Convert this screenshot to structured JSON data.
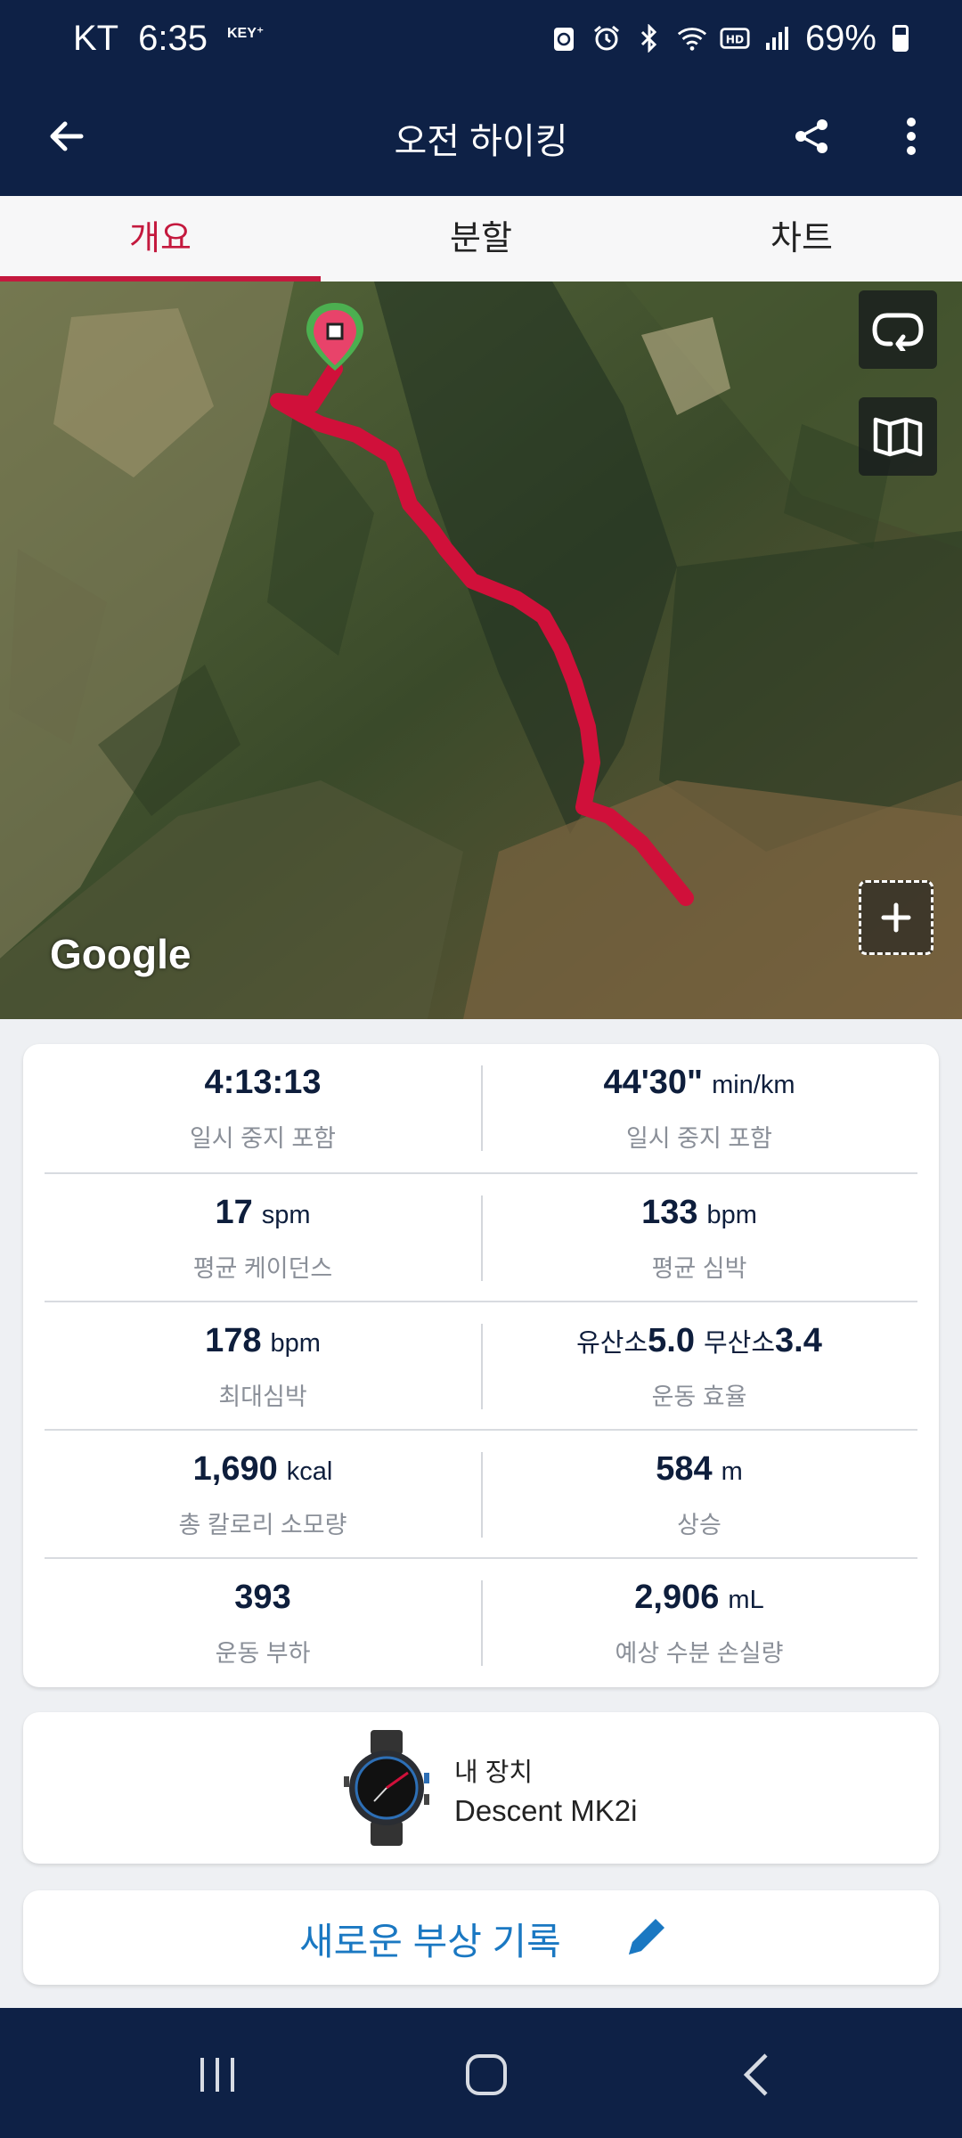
{
  "status_bar": {
    "carrier": "KT",
    "time": "6:35",
    "key_badge": "KEY⁺",
    "battery": "69%",
    "icons": [
      "recycle-icon",
      "alarm-icon",
      "bluetooth-icon",
      "wifi-icon",
      "hd-icon",
      "signal-icon",
      "battery-icon"
    ]
  },
  "app_bar": {
    "title": "오전 하이킹",
    "back_icon": "arrow-left-icon",
    "share_icon": "share-icon",
    "more_icon": "more-vertical-icon"
  },
  "tabs": [
    {
      "label": "개요",
      "active": true
    },
    {
      "label": "분할",
      "active": false
    },
    {
      "label": "차트",
      "active": false
    }
  ],
  "map": {
    "logo": "Google",
    "route_color": "#d0103a",
    "accent_color": "#c4193e"
  },
  "stats": [
    [
      {
        "value": "4:13:13",
        "unit": "",
        "label": "일시 중지 포함"
      },
      {
        "value": "44'30\"",
        "unit": "min/km",
        "label": "일시 중지 포함"
      }
    ],
    [
      {
        "value": "17",
        "unit": "spm",
        "label": "평균 케이던스"
      },
      {
        "value": "133",
        "unit": "bpm",
        "label": "평균 심박"
      }
    ],
    [
      {
        "value": "178",
        "unit": "bpm",
        "label": "최대심박"
      },
      {
        "aerobic_label": "유산소",
        "aerobic_value": "5.0",
        "anaerobic_label": "무산소",
        "anaerobic_value": "3.4",
        "label": "운동 효율"
      }
    ],
    [
      {
        "value": "1,690",
        "unit": "kcal",
        "label": "총 칼로리 소모량"
      },
      {
        "value": "584",
        "unit": "m",
        "label": "상승"
      }
    ],
    [
      {
        "value": "393",
        "unit": "",
        "label": "운동 부하"
      },
      {
        "value": "2,906",
        "unit": "mL",
        "label": "예상 수분 손실량"
      }
    ]
  ],
  "device": {
    "label": "내 장치",
    "name": "Descent MK2i"
  },
  "injury": {
    "label": "새로운 부상 기록",
    "icon": "pencil-icon",
    "color": "#1a78c2"
  }
}
